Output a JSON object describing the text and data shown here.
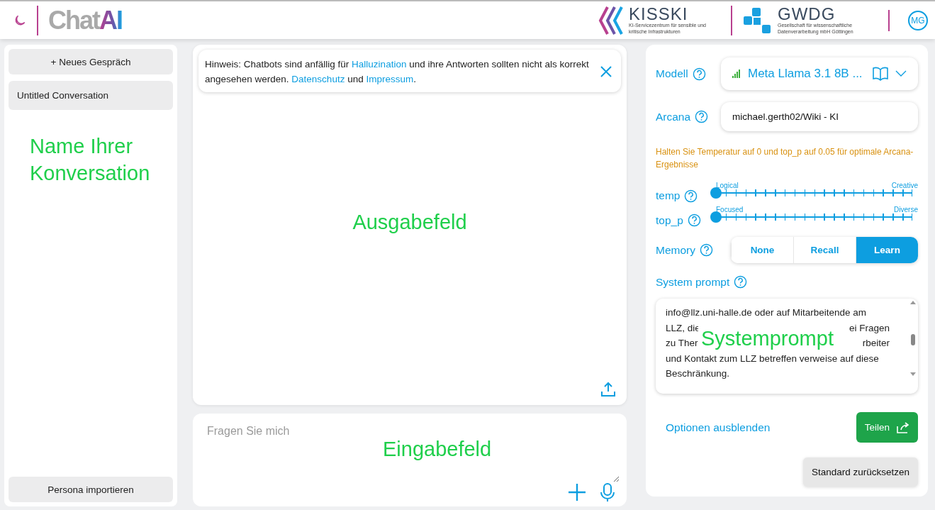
{
  "header": {
    "logo": {
      "plain": "Chat",
      "accent": "AI"
    },
    "partners": [
      {
        "name": "KISSKI",
        "subtitle": "KI-Servicezentrum für sensible und kritische Infrastrukturen",
        "kind": "kisski"
      },
      {
        "name": "GWDG",
        "subtitle": "Gesellschaft für wissenschaftliche Datenverarbeitung mbH Göttingen",
        "kind": "gwdg"
      }
    ],
    "avatar": "MG"
  },
  "sidebar": {
    "new_button": "+ Neues Gespräch",
    "conversations": [
      {
        "title": "Untitled Conversation",
        "selected": true
      }
    ],
    "annotation": "Name Ihrer Konversation",
    "import_button": "Persona importieren"
  },
  "output": {
    "notice": [
      {
        "kind": "text",
        "text": "Hinweis: Chatbots sind anfällig für "
      },
      {
        "kind": "link",
        "text": "Halluzination"
      },
      {
        "kind": "text",
        "text": " und ihre Antworten sollten nicht als korrekt angesehen werden. "
      },
      {
        "kind": "link",
        "text": "Datenschutz"
      },
      {
        "kind": "text",
        "text": " und "
      },
      {
        "kind": "link",
        "text": "Impressum"
      },
      {
        "kind": "text",
        "text": "."
      }
    ],
    "annotation": "Ausgabefeld"
  },
  "input": {
    "placeholder": "Fragen Sie mich",
    "annotation": "Eingabefeld"
  },
  "settings": {
    "model": {
      "label": "Modell",
      "value": "Meta Llama 3.1 8B ..."
    },
    "arcana": {
      "label": "Arcana",
      "value": "michael.gerth02/Wiki - KI"
    },
    "warning": "Halten Sie Temperatur auf 0 und top_p auf 0.05 für optimale Arcana-Ergebnisse",
    "sliders": [
      {
        "label": "temp",
        "min_label": "Logical",
        "max_label": "Creative",
        "level": 0
      },
      {
        "label": "top_p",
        "min_label": "Focused",
        "max_label": "Diverse",
        "level": 0
      }
    ],
    "memory": {
      "label": "Memory",
      "options": [
        {
          "label": "None",
          "selected": false
        },
        {
          "label": "Recall",
          "selected": false
        },
        {
          "label": "Learn",
          "selected": true
        }
      ]
    },
    "system_prompt": {
      "label": "System prompt",
      "lines": [
        [
          "info@llz.uni-halle.de oder auf Mitarbeitende am"
        ],
        [
          "LLZ, die",
          "ei Fragen"
        ],
        [
          "zu Ther",
          "rbeiter"
        ],
        [
          "und Kontakt zum LLZ betreffen verweise auf diese"
        ],
        [
          "Beschränkung."
        ]
      ],
      "annotation": "Systemprompt"
    },
    "hide_link": "Optionen ausblenden",
    "share_button": "Teilen",
    "reset_button": "Standard zurücksetzen"
  }
}
